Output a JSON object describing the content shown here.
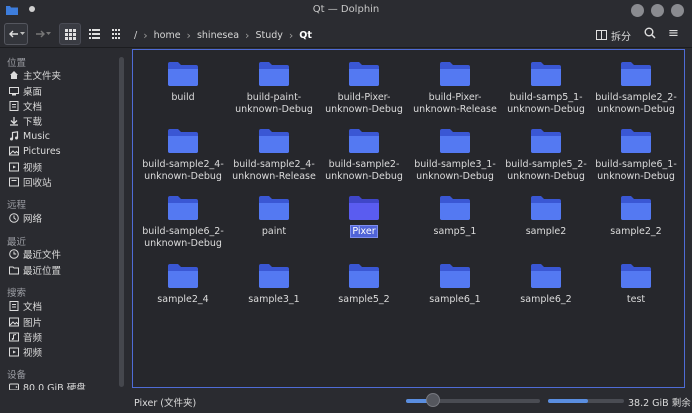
{
  "window": {
    "title": "Qt — Dolphin"
  },
  "breadcrumb": [
    "/",
    "home",
    "shinesea",
    "Study",
    "Qt"
  ],
  "toolbar": {
    "split_label": "拆分"
  },
  "sidebar": {
    "places_label": "位置",
    "places": [
      {
        "label": "主文件夹",
        "icon": "home-icon"
      },
      {
        "label": "桌面",
        "icon": "desktop-icon"
      },
      {
        "label": "文档",
        "icon": "document-icon"
      },
      {
        "label": "下载",
        "icon": "download-icon"
      },
      {
        "label": "Music",
        "icon": "music-icon"
      },
      {
        "label": "Pictures",
        "icon": "picture-icon"
      },
      {
        "label": "视频",
        "icon": "video-icon"
      },
      {
        "label": "回收站",
        "icon": "trash-icon"
      }
    ],
    "remote_label": "远程",
    "remote": [
      {
        "label": "网络",
        "icon": "network-icon"
      }
    ],
    "recent_label": "最近",
    "recent": [
      {
        "label": "最近文件",
        "icon": "clock-icon"
      },
      {
        "label": "最近位置",
        "icon": "folder-recent-icon"
      }
    ],
    "search_label": "搜索",
    "search": [
      {
        "label": "文档",
        "icon": "document-icon"
      },
      {
        "label": "图片",
        "icon": "picture-icon"
      },
      {
        "label": "音频",
        "icon": "audio-icon"
      },
      {
        "label": "视频",
        "icon": "video-icon"
      }
    ],
    "devices_label": "设备",
    "devices": [
      {
        "label": "80.0 GiB 硬盘",
        "icon": "harddisk-icon",
        "used_fraction": 0.7
      }
    ]
  },
  "files": [
    [
      "build"
    ],
    [
      "build-paint-",
      "unknown-Debug"
    ],
    [
      "build-Pixer-",
      "unknown-Debug"
    ],
    [
      "build-Pixer-",
      "unknown-Release"
    ],
    [
      "build-samp5_1-",
      "unknown-Debug"
    ],
    [
      "build-sample2_2-",
      "unknown-Debug"
    ],
    [
      "build-sample2_4-",
      "unknown-Debug"
    ],
    [
      "build-sample2_4-",
      "unknown-Release"
    ],
    [
      "build-sample2-",
      "unknown-Debug"
    ],
    [
      "build-sample3_1-",
      "unknown-Debug"
    ],
    [
      "build-sample5_2-",
      "unknown-Debug"
    ],
    [
      "build-sample6_1-",
      "unknown-Debug"
    ],
    [
      "build-sample6_2-",
      "unknown-Debug"
    ],
    [
      "paint"
    ],
    [
      "Pixer"
    ],
    [
      "samp5_1"
    ],
    [
      "sample2"
    ],
    [
      "sample2_2"
    ],
    [
      "sample2_4"
    ],
    [
      "sample3_1"
    ],
    [
      "sample5_2"
    ],
    [
      "sample6_1"
    ],
    [
      "sample6_2"
    ],
    [
      "test"
    ]
  ],
  "selected_file": "Pixer",
  "statusbar": {
    "selection_text": "Pixer (文件夹)",
    "zoom_fraction": 0.2,
    "free_space_text": "38.2 GiB 剩余",
    "used_fraction": 0.52
  },
  "colors": {
    "accent": "#5a8ee0",
    "folder": "#4f6ff0",
    "selection": "#5064d8"
  }
}
